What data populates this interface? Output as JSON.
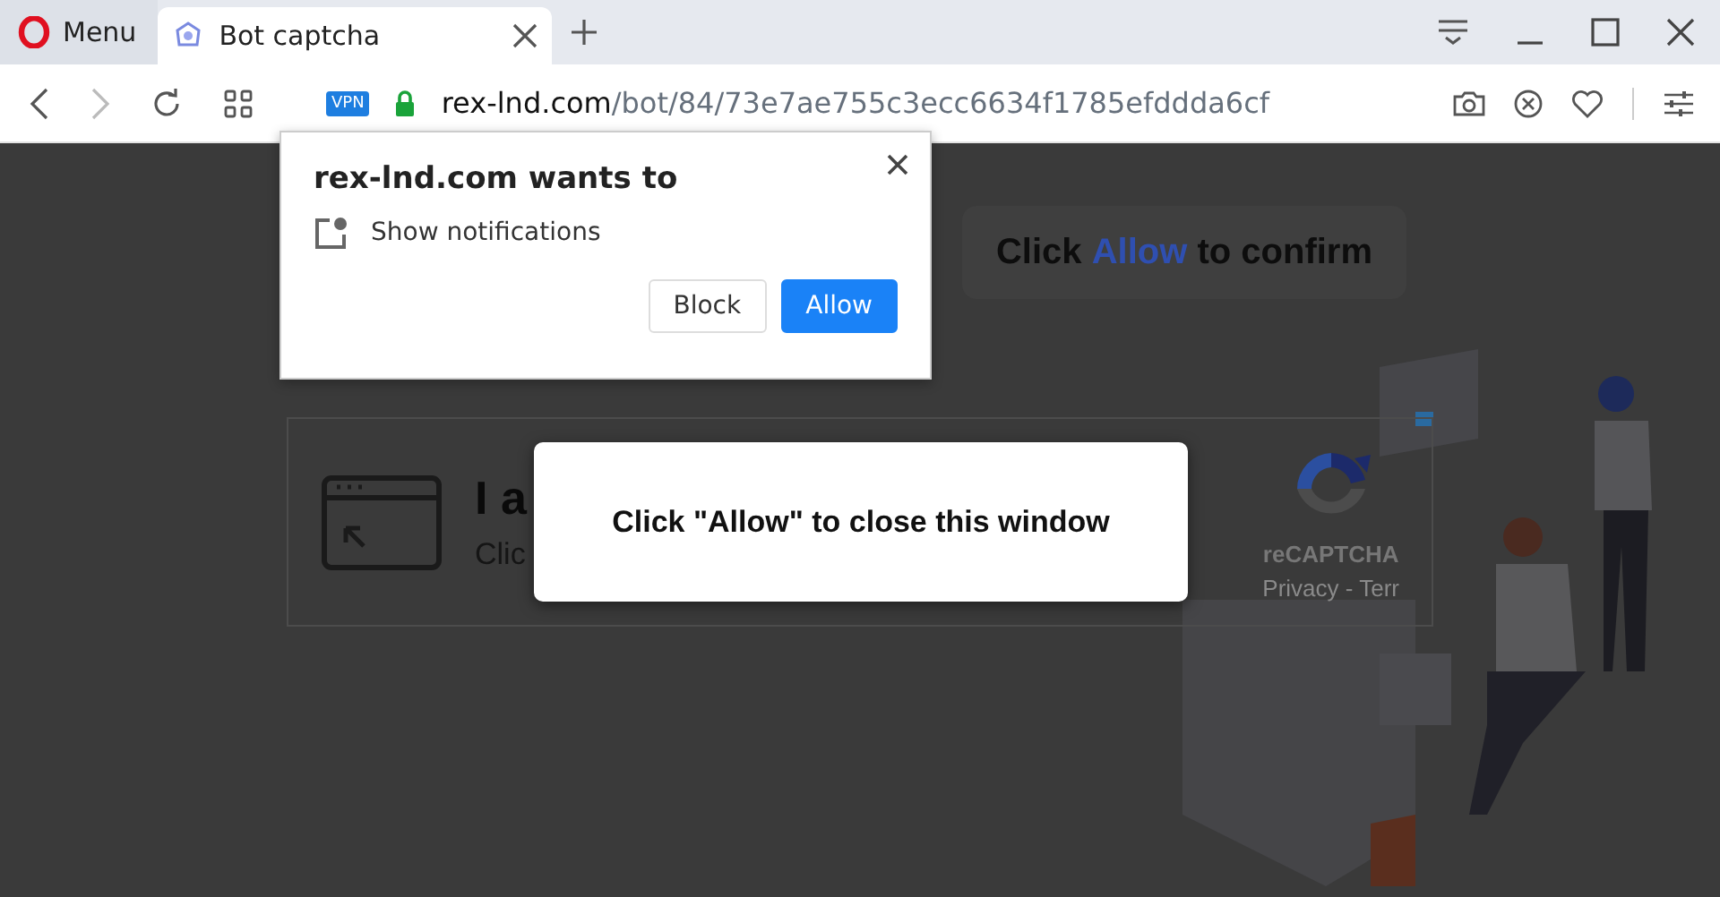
{
  "browser": {
    "menu_label": "Menu",
    "tabs": [
      {
        "title": "Bot captcha",
        "selected": true
      }
    ],
    "address": {
      "vpn_badge": "VPN",
      "domain": "rex-lnd.com",
      "path": "/bot/84/73e7ae755c3ecc6634f1785efddda6cf"
    }
  },
  "permission_prompt": {
    "title": "rex-lnd.com wants to",
    "permission": "Show notifications",
    "buttons": [
      {
        "label": "Block",
        "kind": "secondary"
      },
      {
        "label": "Allow",
        "kind": "primary"
      }
    ]
  },
  "page": {
    "banner": {
      "before": "Click",
      "highlight": "Allow",
      "after": "to confirm"
    },
    "captcha_card": {
      "heading": "I a",
      "subtext": "Clic",
      "recaptcha_label": "reCAPTCHA",
      "recaptcha_links": "Privacy - Terr"
    },
    "modal": {
      "message": "Click \"Allow\" to close this window"
    }
  }
}
